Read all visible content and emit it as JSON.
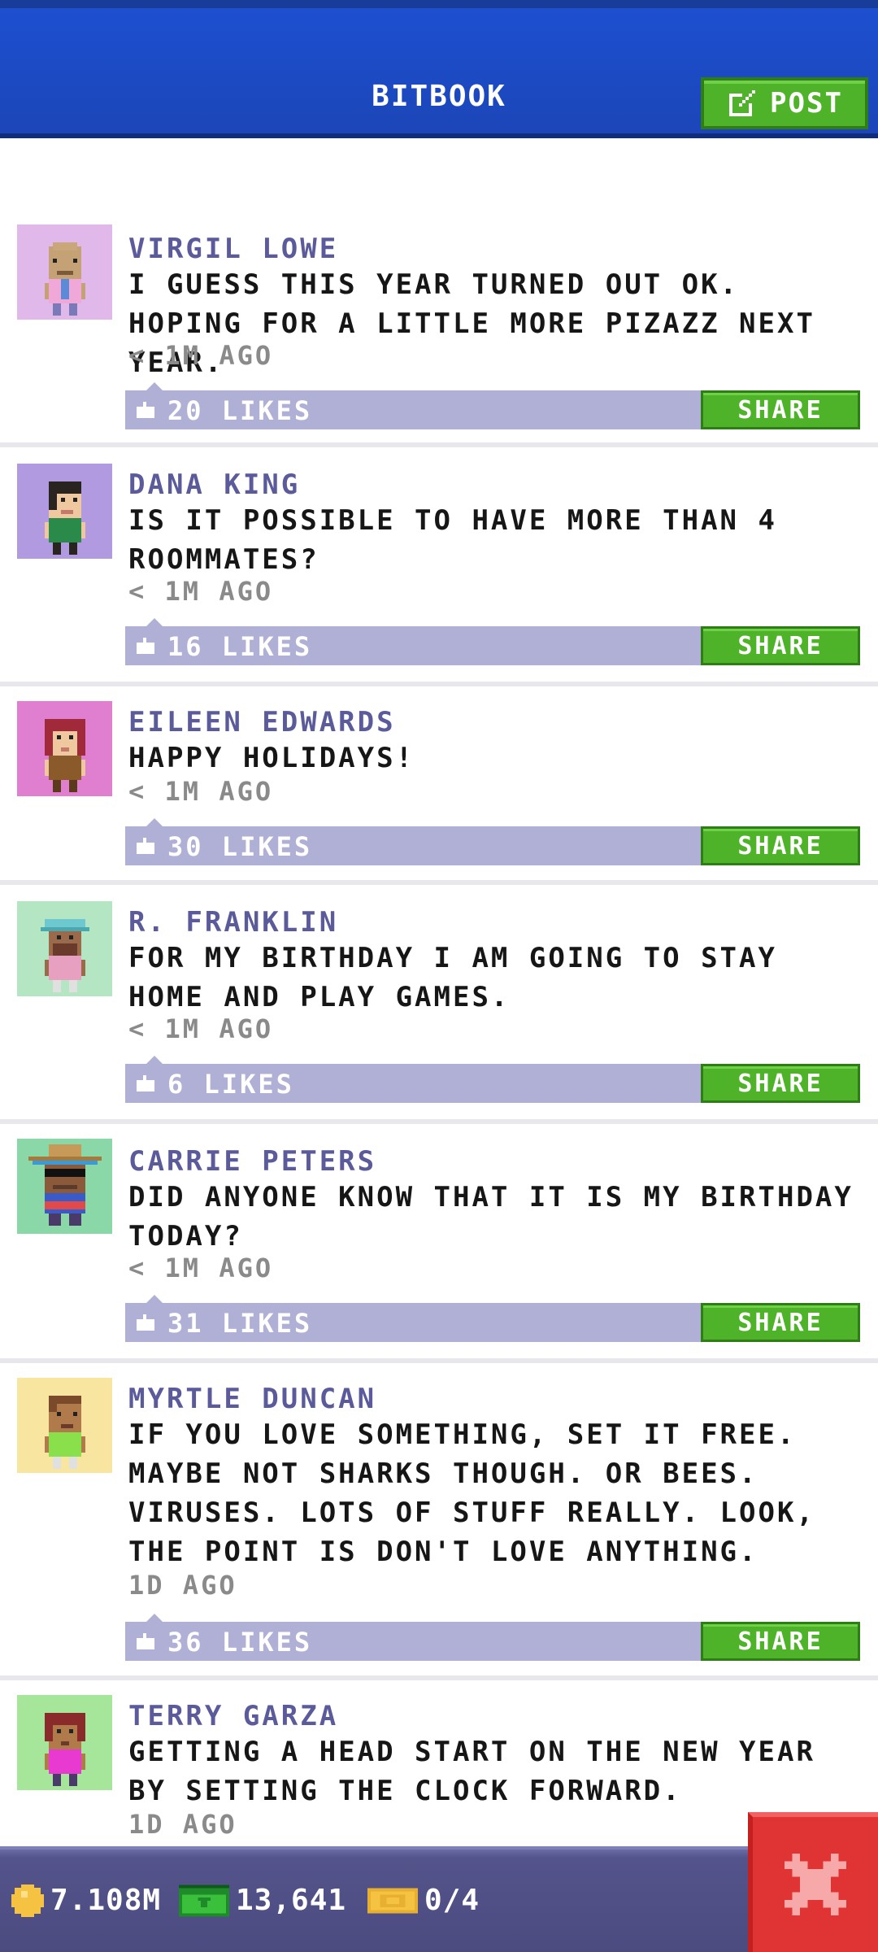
{
  "header": {
    "title": "BITBOOK",
    "post_label": "POST"
  },
  "colors": {
    "header_blue": "#1d4fd0",
    "post_name": "#5b5a9b",
    "like_bar": "#b0b0d6",
    "share_green": "#4fb32a",
    "close_red": "#e03434",
    "bottom_bar": "#4b4b80"
  },
  "posts": [
    {
      "name": "VIRGIL LOWE",
      "text": "I GUESS THIS YEAR TURNED OUT OK. HOPING FOR A LITTLE MORE PIZAZZ NEXT YEAR.",
      "time": "< 1M AGO",
      "likes": "20 LIKES",
      "share": "SHARE",
      "avatar_bg": "#e0b8ea"
    },
    {
      "name": "DANA KING",
      "text": "IS IT POSSIBLE TO HAVE MORE THAN 4 ROOMMATES?",
      "time": "< 1M AGO",
      "likes": "16 LIKES",
      "share": "SHARE",
      "avatar_bg": "#b19ae0"
    },
    {
      "name": "EILEEN EDWARDS",
      "text": "HAPPY HOLIDAYS!",
      "time": "< 1M AGO",
      "likes": "30 LIKES",
      "share": "SHARE",
      "avatar_bg": "#e07ed0"
    },
    {
      "name": "R. FRANKLIN",
      "text": "FOR MY BIRTHDAY I AM GOING TO STAY HOME AND PLAY GAMES.",
      "time": "< 1M AGO",
      "likes": "6 LIKES",
      "share": "SHARE",
      "avatar_bg": "#b4e6c4"
    },
    {
      "name": "CARRIE PETERS",
      "text": "DID ANYONE KNOW THAT IT IS MY BIRTHDAY TODAY?",
      "time": "< 1M AGO",
      "likes": "31 LIKES",
      "share": "SHARE",
      "avatar_bg": "#8ad8a8"
    },
    {
      "name": "MYRTLE DUNCAN",
      "text": "IF YOU LOVE SOMETHING, SET IT FREE. MAYBE NOT SHARKS THOUGH. OR BEES. VIRUSES. LOTS OF STUFF REALLY. LOOK, THE POINT IS DON'T LOVE ANYTHING.",
      "time": "1D AGO",
      "likes": "36 LIKES",
      "share": "SHARE",
      "avatar_bg": "#f8e6a0"
    },
    {
      "name": "TERRY GARZA",
      "text": "GETTING A HEAD START ON THE NEW YEAR BY SETTING THE CLOCK FORWARD.",
      "time": "1D AGO",
      "likes": "",
      "share": "",
      "avatar_bg": "#a6e69a"
    }
  ],
  "bottom": {
    "coins": "7.108M",
    "cash": "13,641",
    "tickets": "0/4",
    "coin_icon": "coin-icon",
    "cash_icon": "bux-icon",
    "ticket_icon": "ticket-icon",
    "close_icon": "close-icon"
  }
}
